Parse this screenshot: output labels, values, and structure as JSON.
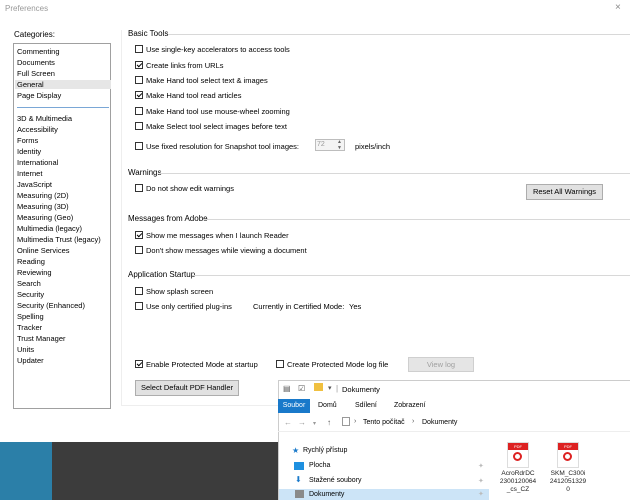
{
  "window": {
    "title": "Preferences",
    "close": "×"
  },
  "categories": {
    "label": "Categories:",
    "top_items": [
      "Commenting",
      "Documents",
      "Full Screen",
      "General",
      "Page Display"
    ],
    "selected": "General",
    "items": [
      "3D & Multimedia",
      "Accessibility",
      "Forms",
      "Identity",
      "International",
      "Internet",
      "JavaScript",
      "Measuring (2D)",
      "Measuring (3D)",
      "Measuring (Geo)",
      "Multimedia (legacy)",
      "Multimedia Trust (legacy)",
      "Online Services",
      "Reading",
      "Reviewing",
      "Search",
      "Security",
      "Security (Enhanced)",
      "Spelling",
      "Tracker",
      "Trust Manager",
      "Units",
      "Updater"
    ]
  },
  "basic_tools": {
    "title": "Basic Tools",
    "options": [
      {
        "label": "Use single-key accelerators to access tools",
        "checked": false
      },
      {
        "label": "Create links from URLs",
        "checked": true
      },
      {
        "label": "Make Hand tool select text & images",
        "checked": false
      },
      {
        "label": "Make Hand tool read articles",
        "checked": true
      },
      {
        "label": "Make Hand tool use mouse-wheel zooming",
        "checked": false
      },
      {
        "label": "Make Select tool select images before text",
        "checked": false
      }
    ],
    "snapshot_label": "Use fixed resolution for Snapshot tool images:",
    "snapshot_value": "72",
    "snapshot_unit": "pixels/inch"
  },
  "warnings": {
    "title": "Warnings",
    "option": "Do not show edit warnings",
    "reset_button": "Reset All Warnings"
  },
  "messages": {
    "title": "Messages from Adobe",
    "options": [
      {
        "label": "Show me messages when I launch Reader",
        "checked": true
      },
      {
        "label": "Don't show messages while viewing a document",
        "checked": false
      }
    ]
  },
  "startup": {
    "title": "Application Startup",
    "splash": "Show splash screen",
    "certified": "Use only certified plug-ins",
    "certified_mode_label": "Currently in Certified Mode:",
    "certified_mode_value": "Yes",
    "protected_mode": "Enable Protected Mode at startup",
    "protected_log": "Create Protected Mode log file",
    "view_log": "View log",
    "default_pdf": "Select Default PDF Handler"
  },
  "explorer": {
    "title": "Dokumenty",
    "tabs": [
      "Soubor",
      "Domů",
      "Sdílení",
      "Zobrazení"
    ],
    "breadcrumb": [
      "Tento počítač",
      "Dokumenty"
    ],
    "nav_items": [
      "Rychlý přístup",
      "Plocha",
      "Stažené soubory",
      "Dokumenty"
    ],
    "files": [
      {
        "name": "AcroRdrDC\n2300120064\n_cs_CZ"
      },
      {
        "name": "SKM_C300i\n2412051329\n0"
      }
    ]
  },
  "colors": {
    "accent": "#1979ca",
    "pdf": "#dd2222",
    "desktop_blue": "#2b7fa8"
  }
}
